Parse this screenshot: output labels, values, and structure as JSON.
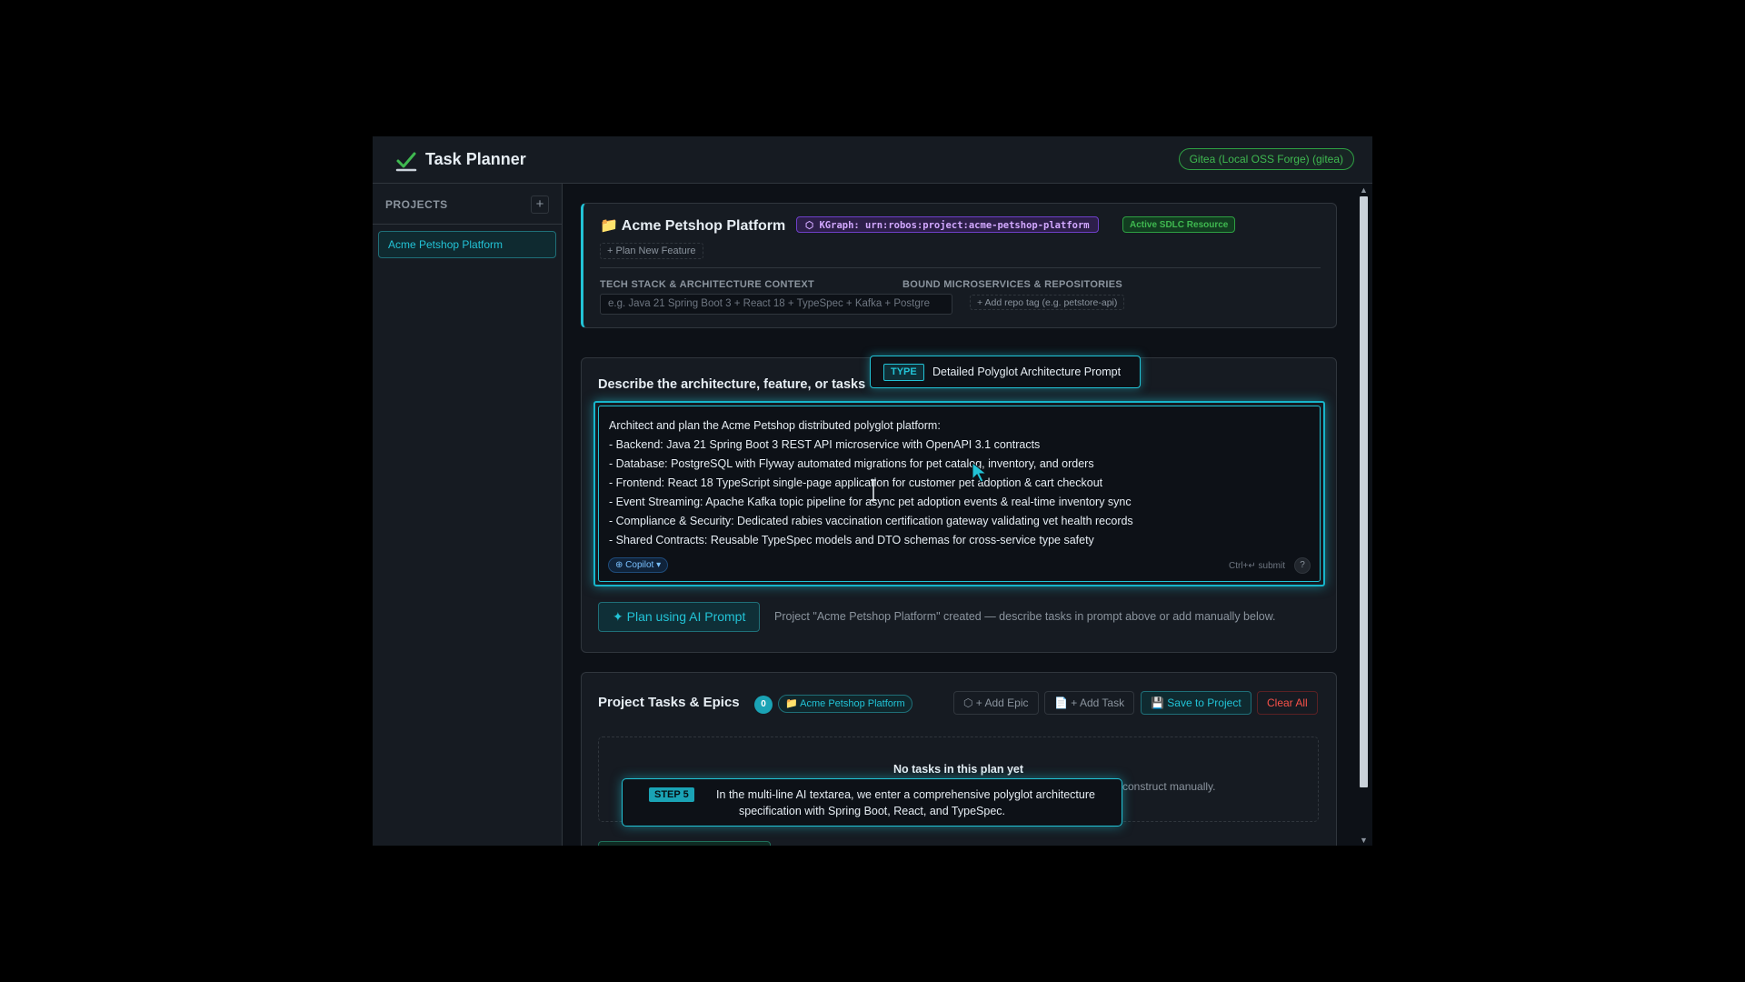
{
  "app": {
    "title": "Task Planner",
    "forge_badge": "Gitea (Local OSS Forge) (gitea)"
  },
  "sidebar": {
    "heading": "PROJECTS",
    "add_label": "+",
    "items": [
      {
        "label": "Acme Petshop Platform",
        "active": true
      }
    ]
  },
  "project": {
    "title": "📁 Acme Petshop Platform",
    "kgraph": "⬡ KGraph: urn:robos:project:acme-petshop-platform",
    "active_badge": "Active SDLC Resource",
    "plan_feature": "+ Plan New Feature",
    "tech_label": "TECH STACK & ARCHITECTURE CONTEXT",
    "tech_placeholder": "e.g. Java 21 Spring Boot 3 + React 18 + TypeSpec + Kafka + Postgre",
    "repos_label": "BOUND MICROSERVICES & REPOSITORIES",
    "repo_tag": "+ Add repo tag (e.g. petstore-api)"
  },
  "prompt": {
    "heading": "Describe the architecture, feature, or tasks",
    "lines": [
      "Architect and plan the Acme Petshop distributed polyglot platform:",
      "- Backend: Java 21 Spring Boot 3 REST API microservice with OpenAPI 3.1 contracts",
      "- Database: PostgreSQL with Flyway automated migrations for pet catalog, inventory, and orders",
      "- Frontend: React 18 TypeScript single-page application for customer pet adoption & cart checkout",
      "- Event Streaming: Apache Kafka topic pipeline for async pet adoption events & real-time inventory sync",
      "- Compliance & Security: Dedicated rabies vaccination certification gateway validating vet health records",
      "- Shared Contracts: Reusable TypeSpec models and DTO schemas for cross-service type safety"
    ],
    "copilot": "⊕ Copilot ▾",
    "submit_hint": "Ctrl+↵ submit",
    "help": "?",
    "plan_button": "✦ Plan using AI Prompt",
    "status": "Project \"Acme Petshop Platform\" created — describe tasks in prompt above or add manually below."
  },
  "tasks": {
    "title": "Project Tasks & Epics",
    "count": "0",
    "project_chip": "📁 Acme Petshop Platform",
    "add_epic": "⬡ + Add Epic",
    "add_task": "📄 + Add Task",
    "save": "💾 Save to Project",
    "clear": "Clear All",
    "empty_title": "No tasks in this plan yet",
    "empty_sub": "construct manually."
  },
  "overlays": {
    "type_tag": "TYPE",
    "type_text": "Detailed Polyglot Architecture Prompt",
    "step_tag": "STEP 5",
    "step_text": "In the multi-line AI textarea, we enter a comprehensive polyglot architecture specification with Spring Boot, React, and TypeSpec."
  },
  "colors": {
    "accent": "#22c3d6",
    "success": "#3fb950",
    "danger": "#f85149",
    "purple": "#d2a8ff",
    "background": "#0d1117"
  }
}
